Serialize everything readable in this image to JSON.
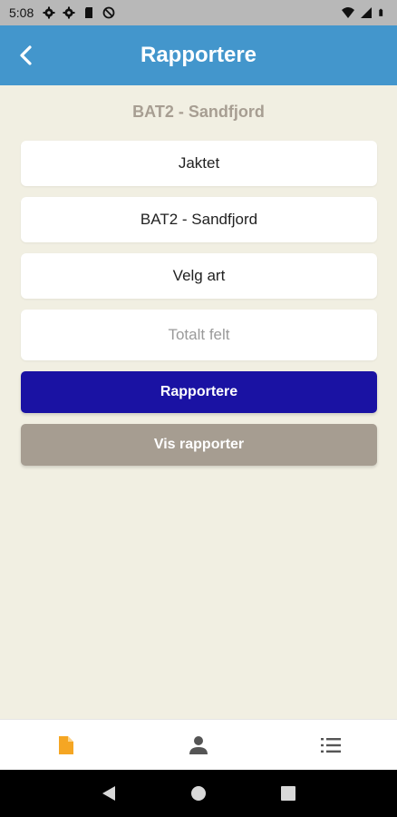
{
  "status_bar": {
    "time": "5:08",
    "icons": [
      "gear-icon",
      "gear-icon",
      "sd-card-icon",
      "no-sync-icon"
    ],
    "right_icons": [
      "wifi-icon",
      "signal-icon",
      "battery-icon"
    ]
  },
  "header": {
    "title": "Rapportere",
    "back_icon": "chevron-left-icon",
    "color": "#4396cc"
  },
  "form": {
    "subtitle": "BAT2 - Sandfjord",
    "fields": [
      {
        "value": "Jaktet"
      },
      {
        "value": "BAT2 - Sandfjord"
      },
      {
        "value": "Velg art"
      }
    ],
    "total_placeholder": "Totalt felt"
  },
  "buttons": {
    "report_label": "Rapportere",
    "report_color": "#1a12a3",
    "show_reports_label": "Vis rapporter",
    "show_reports_color": "#a69d91"
  },
  "bottom_nav": {
    "items": [
      {
        "icon": "document-icon",
        "active": true,
        "color": "#f5a623"
      },
      {
        "icon": "person-icon",
        "active": false
      },
      {
        "icon": "list-icon",
        "active": false
      }
    ]
  },
  "system_nav": {
    "icons": [
      "back-triangle-icon",
      "home-circle-icon",
      "recents-square-icon"
    ]
  }
}
